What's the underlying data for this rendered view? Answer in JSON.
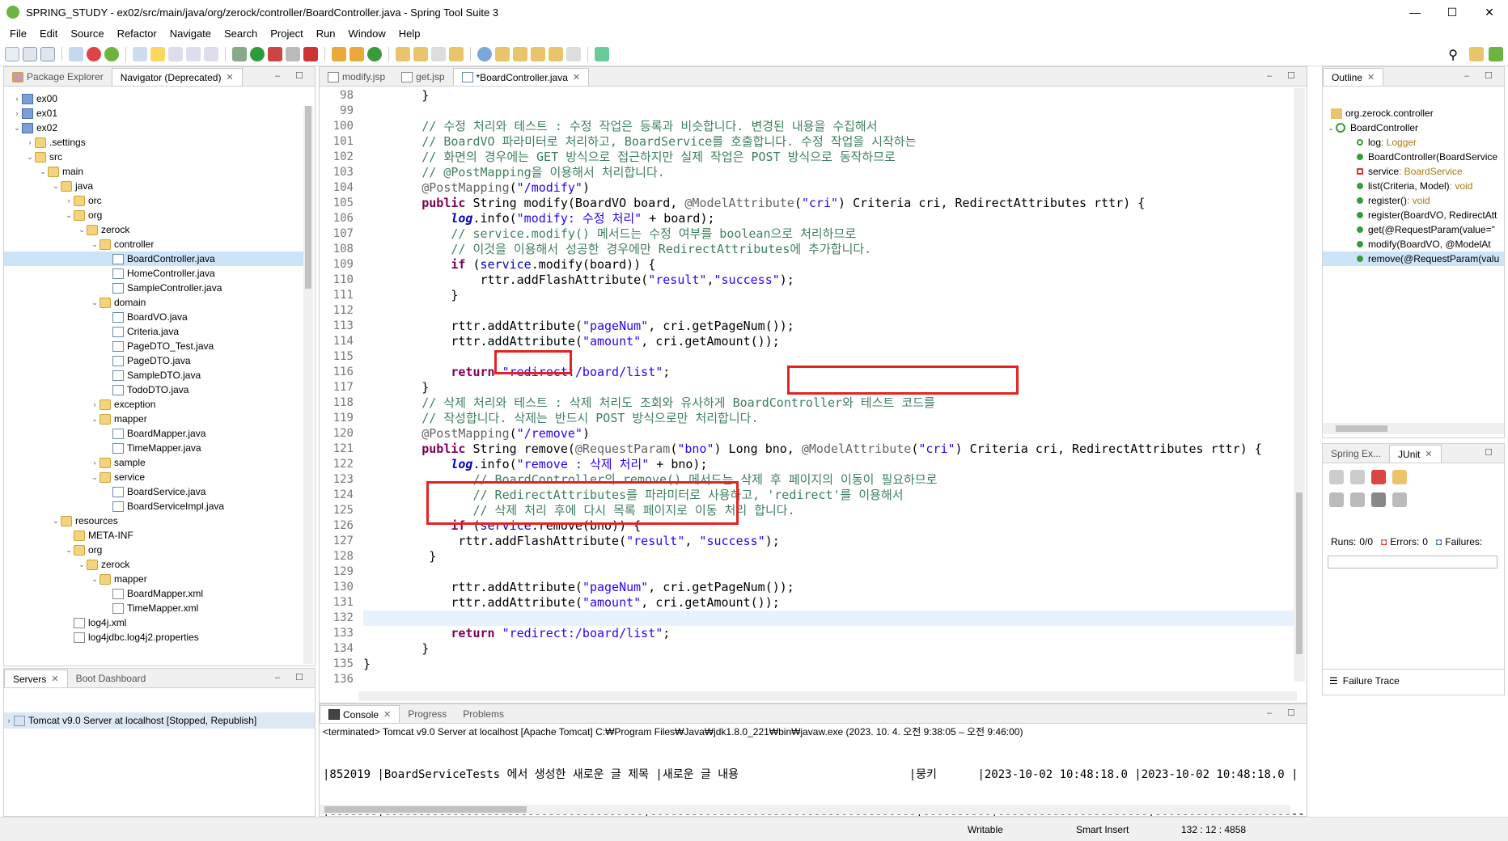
{
  "window": {
    "title": "SPRING_STUDY - ex02/src/main/java/org/zerock/controller/BoardController.java - Spring Tool Suite 3",
    "min": "—",
    "max": "☐",
    "close": "✕"
  },
  "menu": [
    "File",
    "Edit",
    "Source",
    "Refactor",
    "Navigate",
    "Search",
    "Project",
    "Run",
    "Window",
    "Help"
  ],
  "left_tabs": {
    "package_explorer": "Package Explorer",
    "navigator": "Navigator (Deprecated)"
  },
  "tree": [
    {
      "label": "ex00",
      "depth": 0,
      "icon": "proj",
      "tw": "›"
    },
    {
      "label": "ex01",
      "depth": 0,
      "icon": "proj",
      "tw": "›"
    },
    {
      "label": "ex02",
      "depth": 0,
      "icon": "proj",
      "tw": "⌄"
    },
    {
      "label": ".settings",
      "depth": 1,
      "icon": "folder",
      "tw": "›"
    },
    {
      "label": "src",
      "depth": 1,
      "icon": "folder",
      "tw": "⌄"
    },
    {
      "label": "main",
      "depth": 2,
      "icon": "folder",
      "tw": "⌄"
    },
    {
      "label": "java",
      "depth": 3,
      "icon": "folder",
      "tw": "⌄"
    },
    {
      "label": "orc",
      "depth": 4,
      "icon": "folder",
      "tw": "›"
    },
    {
      "label": "org",
      "depth": 4,
      "icon": "folder",
      "tw": "⌄"
    },
    {
      "label": "zerock",
      "depth": 5,
      "icon": "folder",
      "tw": "⌄"
    },
    {
      "label": "controller",
      "depth": 6,
      "icon": "folder",
      "tw": "⌄"
    },
    {
      "label": "BoardController.java",
      "depth": 7,
      "icon": "java",
      "tw": "",
      "selected": true
    },
    {
      "label": "HomeController.java",
      "depth": 7,
      "icon": "java",
      "tw": ""
    },
    {
      "label": "SampleController.java",
      "depth": 7,
      "icon": "java",
      "tw": ""
    },
    {
      "label": "domain",
      "depth": 6,
      "icon": "folder",
      "tw": "⌄"
    },
    {
      "label": "BoardVO.java",
      "depth": 7,
      "icon": "java",
      "tw": ""
    },
    {
      "label": "Criteria.java",
      "depth": 7,
      "icon": "java",
      "tw": ""
    },
    {
      "label": "PageDTO_Test.java",
      "depth": 7,
      "icon": "java",
      "tw": ""
    },
    {
      "label": "PageDTO.java",
      "depth": 7,
      "icon": "java",
      "tw": ""
    },
    {
      "label": "SampleDTO.java",
      "depth": 7,
      "icon": "java",
      "tw": ""
    },
    {
      "label": "TodoDTO.java",
      "depth": 7,
      "icon": "java",
      "tw": ""
    },
    {
      "label": "exception",
      "depth": 6,
      "icon": "folder",
      "tw": "›"
    },
    {
      "label": "mapper",
      "depth": 6,
      "icon": "folder",
      "tw": "⌄"
    },
    {
      "label": "BoardMapper.java",
      "depth": 7,
      "icon": "java",
      "tw": ""
    },
    {
      "label": "TimeMapper.java",
      "depth": 7,
      "icon": "java",
      "tw": ""
    },
    {
      "label": "sample",
      "depth": 6,
      "icon": "folder",
      "tw": "›"
    },
    {
      "label": "service",
      "depth": 6,
      "icon": "folder",
      "tw": "⌄"
    },
    {
      "label": "BoardService.java",
      "depth": 7,
      "icon": "java",
      "tw": ""
    },
    {
      "label": "BoardServiceImpl.java",
      "depth": 7,
      "icon": "java",
      "tw": ""
    },
    {
      "label": "resources",
      "depth": 3,
      "icon": "folder",
      "tw": "⌄"
    },
    {
      "label": "META-INF",
      "depth": 4,
      "icon": "folder",
      "tw": ""
    },
    {
      "label": "org",
      "depth": 4,
      "icon": "folder",
      "tw": "⌄"
    },
    {
      "label": "zerock",
      "depth": 5,
      "icon": "folder",
      "tw": "⌄"
    },
    {
      "label": "mapper",
      "depth": 6,
      "icon": "folder",
      "tw": "⌄"
    },
    {
      "label": "BoardMapper.xml",
      "depth": 7,
      "icon": "xml",
      "tw": ""
    },
    {
      "label": "TimeMapper.xml",
      "depth": 7,
      "icon": "xml",
      "tw": ""
    },
    {
      "label": "log4j.xml",
      "depth": 4,
      "icon": "xml",
      "tw": ""
    },
    {
      "label": "log4jdbc.log4j2.properties",
      "depth": 4,
      "icon": "xml",
      "tw": ""
    }
  ],
  "servers": {
    "tab": "Servers",
    "boot_tab": "Boot Dashboard",
    "item": "Tomcat v9.0 Server at localhost  [Stopped, Republish]"
  },
  "editor_tabs": [
    "modify.jsp",
    "get.jsp",
    "*BoardController.java"
  ],
  "code": [
    {
      "n": "98",
      "h": "        }"
    },
    {
      "n": "99",
      "h": ""
    },
    {
      "n": "100",
      "h": "        <span class='cm'>// 수정 처리와 테스트 : 수정 작업은 등록과 비슷합니다. 변경된 내용을 수집해서</span>"
    },
    {
      "n": "101",
      "h": "        <span class='cm'>// BoardVO 파라미터로 처리하고, BoardService를 호출합니다. 수정 작업을 시작하는</span>"
    },
    {
      "n": "102",
      "h": "        <span class='cm'>// 화면의 경우에는 GET 방식으로 접근하지만 실제 작업은 POST 방식으로 동작하므로</span>"
    },
    {
      "n": "103",
      "h": "        <span class='cm'>// @PostMapping을 이용해서 처리합니다.</span>"
    },
    {
      "n": "104",
      "h": "        <span class='an'>@PostMapping</span>(<span class='str'>\"/modify\"</span>)"
    },
    {
      "n": "105",
      "h": "        <span class='kw'>public</span> String modify(BoardVO board, <span class='an'>@ModelAttribute</span>(<span class='str'>\"cri\"</span>) Criteria cri, RedirectAttributes rttr) {"
    },
    {
      "n": "106",
      "h": "            <span class='it'>log</span>.info(<span class='str'>\"modify: 수정 처리\"</span> + board);"
    },
    {
      "n": "107",
      "h": "            <span class='cm'>// service.modify() 메서드는 수정 여부를 boolean으로 처리하므로</span>"
    },
    {
      "n": "108",
      "h": "            <span class='cm'>// 이것을 이용해서 성공한 경우에만 RedirectAttributes에 추가합니다.</span>"
    },
    {
      "n": "109",
      "h": "            <span class='kw'>if</span> (<span class='fld'>service</span>.modify(board)) {"
    },
    {
      "n": "110",
      "h": "                rttr.addFlashAttribute(<span class='str'>\"result\"</span>,<span class='str'>\"success\"</span>);"
    },
    {
      "n": "111",
      "h": "            }"
    },
    {
      "n": "112",
      "h": ""
    },
    {
      "n": "113",
      "h": "            rttr.addAttribute(<span class='str'>\"pageNum\"</span>, cri.getPageNum());"
    },
    {
      "n": "114",
      "h": "            rttr.addAttribute(<span class='str'>\"amount\"</span>, cri.getAmount());"
    },
    {
      "n": "115",
      "h": ""
    },
    {
      "n": "116",
      "h": "            <span class='kw'>return</span> <span class='str'>\"redirect:/board/list\"</span>;"
    },
    {
      "n": "117",
      "h": "        }"
    },
    {
      "n": "118",
      "h": "        <span class='cm'>// 삭제 처리와 테스트 : 삭제 처리도 조회와 유사하게 BoardController와 테스트 코드를</span>"
    },
    {
      "n": "119",
      "h": "        <span class='cm'>// 작성합니다. 삭제는 반드시 POST 방식으로만 처리합니다.</span>"
    },
    {
      "n": "120",
      "h": "        <span class='an'>@PostMapping</span>(<span class='str'>\"/remove\"</span>)"
    },
    {
      "n": "121",
      "h": "        <span class='kw'>public</span> String remove(<span class='an'>@RequestParam</span>(<span class='str'>\"bno\"</span>) Long bno, <span class='an'>@ModelAttribute</span>(<span class='str'>\"cri\"</span>) Criteria cri, RedirectAttributes rttr) {"
    },
    {
      "n": "122",
      "h": "            <span class='it'>log</span>.info(<span class='str'>\"remove : 삭제 처리\"</span> + bno);"
    },
    {
      "n": "123",
      "h": "               <span class='cm'>// BoardController의 remove() 메서드는 삭제 후 페이지의 이동이 필요하므로</span>"
    },
    {
      "n": "124",
      "h": "               <span class='cm'>// RedirectAttributes를 파라미터로 사용하고, 'redirect'를 이용해서</span>"
    },
    {
      "n": "125",
      "h": "               <span class='cm'>// 삭제 처리 후에 다시 목록 페이지로 이동 처리 합니다.</span>"
    },
    {
      "n": "126",
      "h": "            <span class='kw'>if</span> (<span class='fld'>service</span>.remove(bno)) {"
    },
    {
      "n": "127",
      "h": "             rttr.addFlashAttribute(<span class='str'>\"result\"</span>, <span class='str'>\"success\"</span>);"
    },
    {
      "n": "128",
      "h": "         }"
    },
    {
      "n": "129",
      "h": ""
    },
    {
      "n": "130",
      "h": "            rttr.addAttribute(<span class='str'>\"pageNum\"</span>, cri.getPageNum());"
    },
    {
      "n": "131",
      "h": "            rttr.addAttribute(<span class='str'>\"amount\"</span>, cri.getAmount());"
    },
    {
      "n": "132",
      "h": "            "
    },
    {
      "n": "133",
      "h": "            <span class='kw'>return</span> <span class='str'>\"redirect:/board/list\"</span>;"
    },
    {
      "n": "134",
      "h": "        }"
    },
    {
      "n": "135",
      "h": "}"
    },
    {
      "n": "136",
      "h": ""
    }
  ],
  "outline": {
    "tab": "Outline",
    "package": "org.zerock.controller",
    "class": "BoardController",
    "items": [
      {
        "label": "log",
        "type": " : Logger",
        "kind": "field"
      },
      {
        "label": "BoardController(BoardService",
        "type": "",
        "kind": "ctor"
      },
      {
        "label": "service",
        "type": " : BoardService",
        "kind": "priv"
      },
      {
        "label": "list(Criteria, Model)",
        "type": " : void",
        "kind": "method"
      },
      {
        "label": "register()",
        "type": " : void",
        "kind": "method"
      },
      {
        "label": "register(BoardVO, RedirectAtt",
        "type": "",
        "kind": "method"
      },
      {
        "label": "get(@RequestParam(value=\"",
        "type": "",
        "kind": "method"
      },
      {
        "label": "modify(BoardVO, @ModelAt",
        "type": "",
        "kind": "method"
      },
      {
        "label": "remove(@RequestParam(valu",
        "type": "",
        "kind": "method",
        "selected": true
      }
    ]
  },
  "junit": {
    "spring_tab": "Spring Ex...",
    "tab": "JUnit",
    "runs_label": "Runs:",
    "runs_value": "0/0",
    "errors_label": "Errors:",
    "errors_value": "0",
    "failures_label": "Failures:",
    "failure_trace": "Failure Trace"
  },
  "console": {
    "tab": "Console",
    "progress_tab": "Progress",
    "problems_tab": "Problems",
    "status": "<terminated> Tomcat v9.0 Server at localhost [Apache Tomcat] C:₩Program Files₩Java₩jdk1.8.0_221₩bin₩javaw.exe  (2023. 10. 4. 오전 9:38:05 – 오전 9:46:00)",
    "lines": [
      "|852019 |BoardServiceTests 에서 생성한 새로운 글 제목 |새로운 글 내용                         |뭉키      |2023-10-02 10:48:18.0 |2023-10-02 10:48:18.0 |",
      "|-------|--------------------------------------|---------------------------------------|----------|----------------------|----------------------|"
    ]
  },
  "status": {
    "writable": "Writable",
    "insert": "Smart Insert",
    "position": "132 : 12 : 4858"
  }
}
